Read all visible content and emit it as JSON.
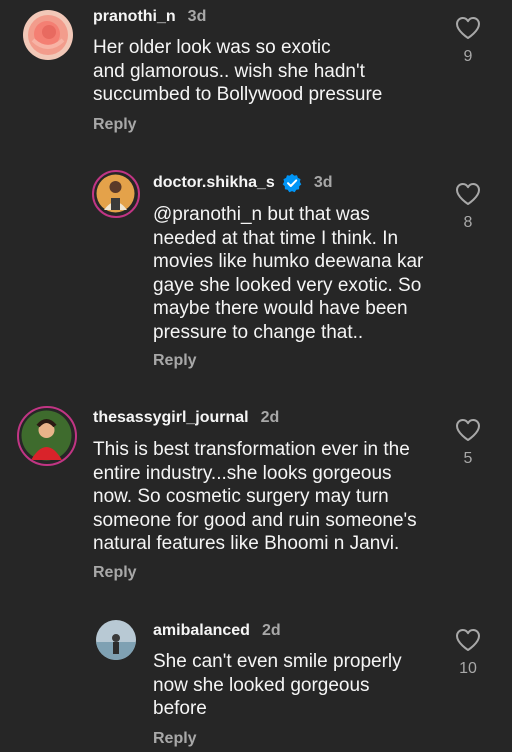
{
  "comments": [
    {
      "username": "pranothi_n",
      "time": "3d",
      "text": "Her older look was so exotic\nand glamorous.. wish she hadn't\nsuccumbed to Bollywood pressure",
      "reply_label": "Reply",
      "likes": "9",
      "verified": false
    },
    {
      "username": "doctor.shikha_s",
      "time": "3d",
      "text": "@pranothi_n but that was\nneeded at that time I think. In\nmovies like humko deewana kar\ngaye she looked very exotic. So\nmaybe there would have been\npressure to change that..",
      "reply_label": "Reply",
      "likes": "8",
      "verified": true
    },
    {
      "username": "thesassygirl_journal",
      "time": "2d",
      "text": "This is best transformation ever in the\nentire industry...she looks gorgeous\nnow. So cosmetic surgery may turn\nsomeone for good and ruin someone's\nnatural features like Bhoomi n Janvi.",
      "reply_label": "Reply",
      "likes": "5",
      "verified": false
    },
    {
      "username": "amibalanced",
      "time": "2d",
      "text": "She can't even smile properly\nnow she looked gorgeous\nbefore",
      "reply_label": "Reply",
      "likes": "10",
      "verified": false
    }
  ],
  "colors": {
    "background": "#262626",
    "text": "#f5f5f5",
    "muted": "#a8a8a8",
    "verified_blue": "#0095f6"
  },
  "icons": {
    "like": "heart-outline-icon",
    "verified": "verified-badge-icon"
  }
}
